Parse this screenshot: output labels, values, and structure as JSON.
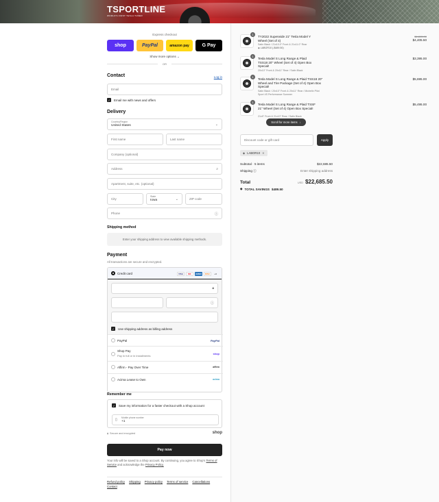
{
  "header": {
    "brand": "TSPORTLINE",
    "tagline": "WORLD'S FIRST TESLA TUNER"
  },
  "express": {
    "title": "Express checkout",
    "buttons": [
      {
        "label": "shop",
        "color": "#5a31f4"
      },
      {
        "label": "PayPal",
        "color": "#ffc439"
      },
      {
        "label": "amazon pay",
        "color": "#ffd814"
      },
      {
        "label": "G Pay",
        "color": "#000000"
      }
    ],
    "more": "Show more options ⌄",
    "or": "OR"
  },
  "contact": {
    "heading": "Contact",
    "login": "Log in",
    "email_placeholder": "Email",
    "newsletter": "Email me with news and offers"
  },
  "delivery": {
    "heading": "Delivery",
    "country_label": "Country/Region",
    "country_value": "United States",
    "first_name": "First name",
    "last_name": "Last name",
    "company": "Company (optional)",
    "address": "Address",
    "apartment": "Apartment, suite, etc. (optional)",
    "city": "City",
    "state_label": "State",
    "state_value": "Iowa",
    "zip": "ZIP code",
    "phone": "Phone"
  },
  "shipping_method": {
    "heading": "Shipping method",
    "note": "Enter your shipping address to view available shipping methods."
  },
  "payment": {
    "heading": "Payment",
    "subtitle": "All transactions are secure and encrypted.",
    "credit_card": "Credit card",
    "card_logos": [
      "VISA",
      "MC",
      "AMEX",
      "DISC"
    ],
    "more_cards": "+4",
    "use_shipping": "Use shipping address as billing address",
    "options": [
      {
        "label": "PayPal",
        "sub": "",
        "brand": "PayPal"
      },
      {
        "label": "Shop Pay",
        "sub": "Pay in full or in installments",
        "brand": "shop"
      },
      {
        "label": "Affirm - Pay Over Time",
        "sub": "",
        "brand": "affirm"
      },
      {
        "label": "Acima Lease to Own",
        "sub": "",
        "brand": "acima"
      }
    ]
  },
  "remember": {
    "heading": "Remember me",
    "save_label": "Save my information for a faster checkout with a Shop account",
    "phone_label": "Mobile phone number",
    "phone_value": "+1",
    "secure": "Secure and encrypted",
    "shop_brand": "shop"
  },
  "pay_now": "Pay now",
  "fine_print": {
    "text": "Your info will be saved to a Shop account. By continuing, you agree to Shop's",
    "terms": "Terms of Service",
    "and": "and acknowledge the",
    "privacy": "Privacy Policy."
  },
  "footer_links": [
    "Refund policy",
    "Shipping",
    "Privacy policy",
    "Terms of service",
    "Cancellations",
    "Contact"
  ],
  "cart": {
    "items": [
      {
        "qty": "1",
        "name": "TY2022 Superwide 21\" Tesla Model Y Wheel (Set of 4)",
        "variant": "Satin Black / 21x10.0\" Front & 21x11.0\" Rear",
        "discount": "LABOR10 (-$489.50)",
        "price_old": "$4,895.00",
        "price": "$4,405.50"
      },
      {
        "qty": "1",
        "name": "Tesla Model S Long Range & Plaid TSS18 20\" Wheel (Set of 4) Open Box Special!",
        "variant": "20x10\" Front & 20x11\" Rear / Satin Black",
        "price": "$3,395.00"
      },
      {
        "qty": "1",
        "name": "Tesla Model S Long Range & Plaid TSS18 20\" Wheel and Tire Package (Set of 4) Open Box Special!",
        "variant": "Satin Black / 20x10\" Front & 20x11\" Rear / Michelin Pilot Sport 4S Performance Summer",
        "price": "$5,695.00"
      },
      {
        "qty": "1",
        "name": "Tesla Model S Long Range & Plaid TSSF 21\" Wheel (Set of 4) Open Box Special!",
        "variant": "21x9\" Front & 21x10\" Rear / Satin Black",
        "price": "$5,495.00"
      }
    ],
    "scroll_hint": "Scroll for more items"
  },
  "summary": {
    "discount_placeholder": "Discount code or gift card",
    "apply": "Apply",
    "code": "LABOR10",
    "subtotal_label": "Subtotal · 5 items",
    "subtotal": "$22,685.50",
    "shipping_label": "Shipping",
    "shipping_value": "Enter shipping address",
    "total_label": "Total",
    "currency": "USD",
    "total": "$22,685.50",
    "savings_label": "TOTAL SAVINGS",
    "savings": "$489.50"
  }
}
